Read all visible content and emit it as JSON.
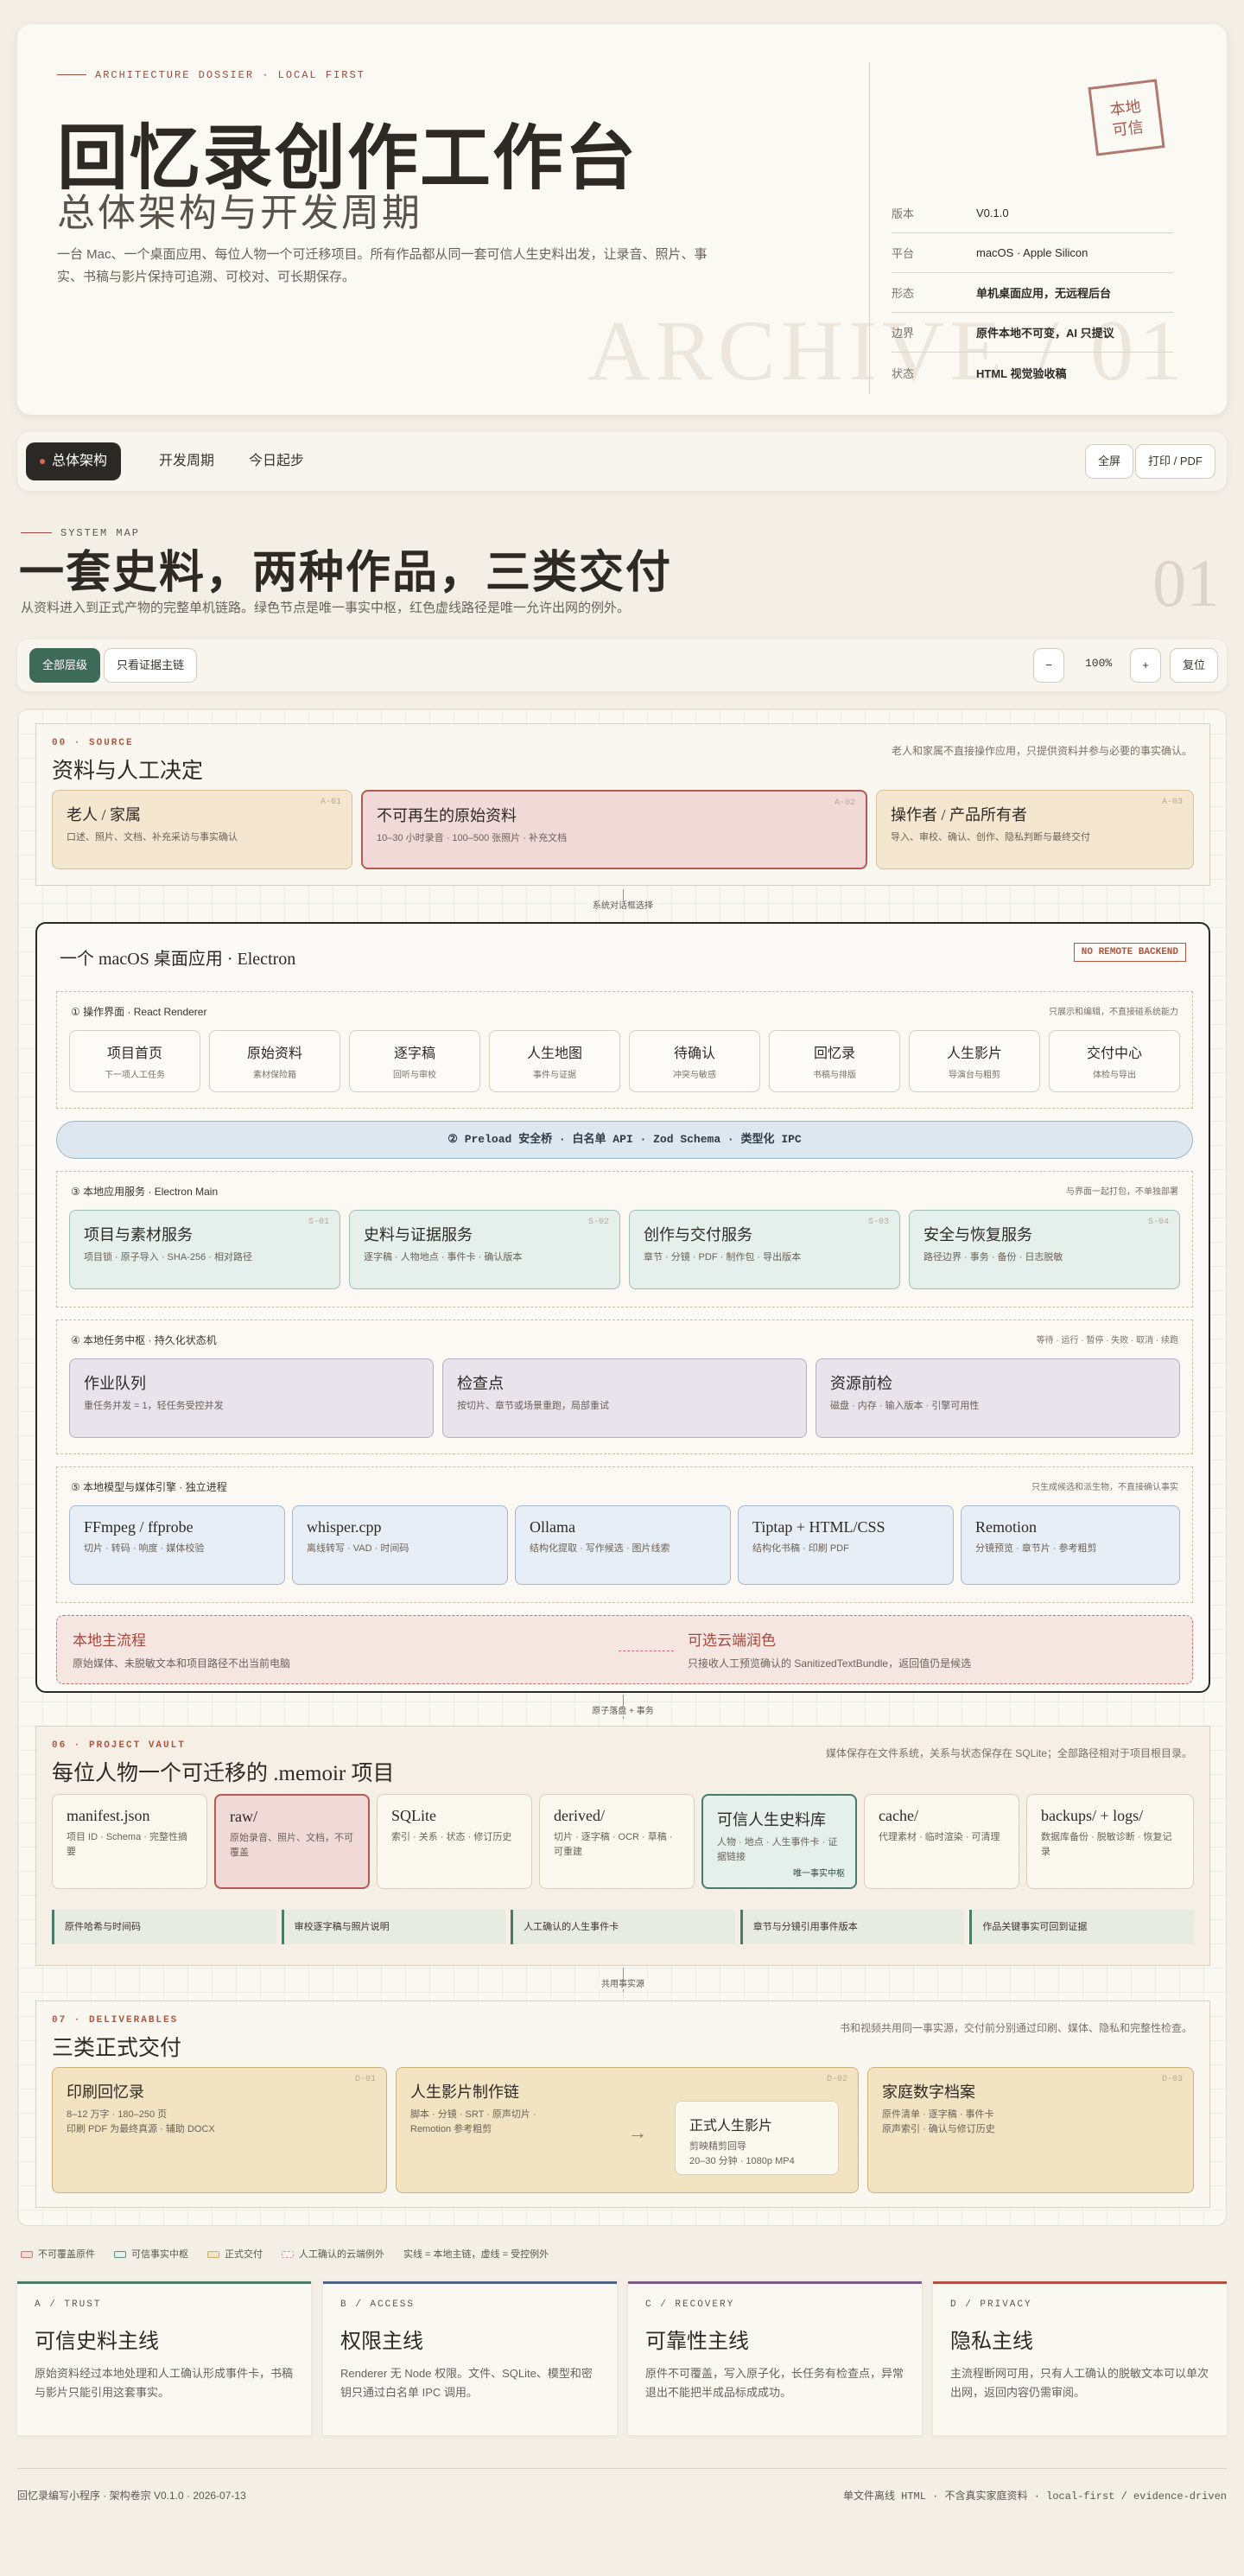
{
  "hero": {
    "kicker": "ARCHITECTURE DOSSIER · LOCAL FIRST",
    "title": "回忆录创作工作台",
    "subtitle": "总体架构与开发周期",
    "desc": "一台 Mac、一个桌面应用、每位人物一个可迁移项目。所有作品都从同一套可信人生史料出发，让录音、照片、事实、书稿与影片保持可追溯、可校对、可长期保存。",
    "watermark": "ARCHIVE / 01",
    "stamp": [
      "本地",
      "可信"
    ],
    "meta": [
      {
        "k": "版本",
        "v": "V0.1.0"
      },
      {
        "k": "平台",
        "v": "macOS · Apple Silicon"
      },
      {
        "k": "形态",
        "v": "单机桌面应用，无远程后台"
      },
      {
        "k": "边界",
        "v": "原件本地不可变，AI 只提议"
      },
      {
        "k": "状态",
        "v": "HTML 视觉验收稿"
      }
    ]
  },
  "tabs": [
    {
      "label": "总体架构"
    },
    {
      "label": "开发周期"
    },
    {
      "label": "今日起步"
    }
  ],
  "actions": {
    "fullscreen": "全屏",
    "print": "打印 / PDF"
  },
  "section": {
    "kicker": "SYSTEM MAP",
    "title": "一套史料，两种作品，三类交付",
    "desc": "从资料进入到正式产物的完整单机链路。绿色节点是唯一事实中枢，红色虚线路径是唯一允许出网的例外。",
    "num": "01"
  },
  "controls": {
    "all": "全部层级",
    "evidence": "只看证据主链",
    "minus": "−",
    "zoom": "100%",
    "plus": "+",
    "reset": "复位"
  },
  "source": {
    "kicker": "00 · SOURCE",
    "title": "资料与人工决定",
    "note": "老人和家属不直接操作应用，只提供资料并参与必要的事实确认。",
    "cards": [
      {
        "t": "老人 / 家属",
        "s": "口述、照片、文档、补充采访与事实确认",
        "id": "A-01"
      },
      {
        "t": "不可再生的原始资料",
        "s": "10–30 小时录音 · 100–500 张照片 · 补充文档",
        "id": "A-02"
      },
      {
        "t": "操作者 / 产品所有者",
        "s": "导入、审校、确认、创作、隐私判断与最终交付",
        "id": "A-03"
      }
    ]
  },
  "conn1": "系统对话框选择",
  "conn2": "原子落盘 + 事务",
  "conn3": "共用事实源",
  "app": {
    "title": "一个 macOS 桌面应用 · Electron",
    "badge": "NO REMOTE BACKEND",
    "ui": {
      "label": "① 操作界面 · React Renderer",
      "note": "只展示和编辑，不直接碰系统能力",
      "items": [
        {
          "t": "项目首页",
          "s": "下一项人工任务"
        },
        {
          "t": "原始资料",
          "s": "素材保险箱"
        },
        {
          "t": "逐字稿",
          "s": "回听与审校"
        },
        {
          "t": "人生地图",
          "s": "事件与证据"
        },
        {
          "t": "待确认",
          "s": "冲突与敏感"
        },
        {
          "t": "回忆录",
          "s": "书稿与排版"
        },
        {
          "t": "人生影片",
          "s": "导演台与粗剪"
        },
        {
          "t": "交付中心",
          "s": "体检与导出"
        }
      ]
    },
    "bridge": "② Preload 安全桥 · 白名单 API · Zod Schema · 类型化 IPC",
    "svc": {
      "label": "③ 本地应用服务 · Electron Main",
      "note": "与界面一起打包，不单独部署",
      "items": [
        {
          "t": "项目与素材服务",
          "s": "项目锁 · 原子导入 · SHA-256 · 相对路径",
          "id": "S-01"
        },
        {
          "t": "史料与证据服务",
          "s": "逐字稿 · 人物地点 · 事件卡 · 确认版本",
          "id": "S-02"
        },
        {
          "t": "创作与交付服务",
          "s": "章节 · 分镜 · PDF · 制作包 · 导出版本",
          "id": "S-03"
        },
        {
          "t": "安全与恢复服务",
          "s": "路径边界 · 事务 · 备份 · 日志脱敏",
          "id": "S-04"
        }
      ]
    },
    "task": {
      "label": "④ 本地任务中枢 · 持久化状态机",
      "note": "等待 · 运行 · 暂停 · 失败 · 取消 · 续跑",
      "items": [
        {
          "t": "作业队列",
          "s": "重任务并发 = 1，轻任务受控并发"
        },
        {
          "t": "检查点",
          "s": "按切片、章节或场景重跑，局部重试"
        },
        {
          "t": "资源前检",
          "s": "磁盘 · 内存 · 输入版本 · 引擎可用性"
        }
      ]
    },
    "eng": {
      "label": "⑤ 本地模型与媒体引擎 · 独立进程",
      "note": "只生成候选和派生物，不直接确认事实",
      "items": [
        {
          "t": "FFmpeg / ffprobe",
          "s": "切片 · 转码 · 响度 · 媒体校验"
        },
        {
          "t": "whisper.cpp",
          "s": "离线转写 · VAD · 时间码"
        },
        {
          "t": "Ollama",
          "s": "结构化提取 · 写作候选 · 图片线索"
        },
        {
          "t": "Tiptap + HTML/CSS",
          "s": "结构化书稿 · 印刷 PDF"
        },
        {
          "t": "Remotion",
          "s": "分镜预览 · 章节片 · 参考粗剪"
        }
      ]
    },
    "local": {
      "t": "本地主流程",
      "s": "原始媒体、未脱敏文本和项目路径不出当前电脑"
    },
    "cloud": {
      "t": "可选云端润色",
      "s": "只接收人工预览确认的 SanitizedTextBundle，返回值仍是候选"
    }
  },
  "vault": {
    "kicker": "06 · PROJECT VAULT",
    "title": "每位人物一个可迁移的 .memoir 项目",
    "note": "媒体保存在文件系统，关系与状态保存在 SQLite；全部路径相对于项目根目录。",
    "items": [
      {
        "t": "manifest.json",
        "s": "项目 ID · Schema · 完整性摘要"
      },
      {
        "t": "raw/",
        "s": "原始录音、照片、文档，不可覆盖"
      },
      {
        "t": "SQLite",
        "s": "索引 · 关系 · 状态 · 修订历史"
      },
      {
        "t": "derived/",
        "s": "切片 · 逐字稿 · OCR · 草稿 · 可重建"
      },
      {
        "t": "可信人生史料库",
        "s": "人物 · 地点 · 人生事件卡 · 证据链接",
        "tag": "唯一事实中枢"
      },
      {
        "t": "cache/",
        "s": "代理素材 · 临时渲染 · 可清理"
      },
      {
        "t": "backups/ + logs/",
        "s": "数据库备份 · 脱敏诊断 · 恢复记录"
      }
    ],
    "chain": [
      "原件哈希与时间码",
      "审校逐字稿与照片说明",
      "人工确认的人生事件卡",
      "章节与分镜引用事件版本",
      "作品关键事实可回到证据"
    ]
  },
  "deliv": {
    "kicker": "07 · DELIVERABLES",
    "title": "三类正式交付",
    "note": "书和视频共用同一事实源，交付前分别通过印刷、媒体、隐私和完整性检查。",
    "items": [
      {
        "t": "印刷回忆录",
        "s": "8–12 万字 · 180–250 页\n印刷 PDF 为最终真源 · 辅助 DOCX",
        "id": "D-01"
      },
      {
        "t": "人生影片制作链",
        "s": "脚本 · 分镜 · SRT · 原声切片 · Remotion 参考粗剪",
        "id": "D-02",
        "sub": {
          "t": "正式人生影片",
          "s": "剪映精剪回导\n20–30 分钟 · 1080p MP4"
        }
      },
      {
        "t": "家庭数字档案",
        "s": "原件清单 · 逐字稿 · 事件卡\n原声索引 · 确认与修订历史",
        "id": "D-03"
      }
    ]
  },
  "legend": [
    {
      "t": "不可覆盖原件",
      "c": "#c77a70"
    },
    {
      "t": "可信事实中枢",
      "c": "#5f8f7c"
    },
    {
      "t": "正式交付",
      "c": "#c9ad6f"
    },
    {
      "t": "人工确认的云端例外",
      "c": "#c9a0a0"
    }
  ],
  "legend_note": "实线 = 本地主链，虚线 = 受控例外",
  "principles": [
    {
      "k": "A / TRUST",
      "t": "可信史料主线",
      "d": "原始资料经过本地处理和人工确认形成事件卡，书稿与影片只能引用这套事实。",
      "c": "#4a7a68"
    },
    {
      "k": "B / ACCESS",
      "t": "权限主线",
      "d": "Renderer 无 Node 权限。文件、SQLite、模型和密钥只通过白名单 IPC 调用。",
      "c": "#4f6288"
    },
    {
      "k": "C / RECOVERY",
      "t": "可靠性主线",
      "d": "原件不可覆盖，写入原子化，长任务有检查点，异常退出不能把半成品标成成功。",
      "c": "#7a5d86"
    },
    {
      "k": "D / PRIVACY",
      "t": "隐私主线",
      "d": "主流程断网可用，只有人工确认的脱敏文本可以单次出网，返回内容仍需审阅。",
      "c": "#b05040"
    }
  ],
  "footer": {
    "left": "回忆录编写小程序 · 架构卷宗 V0.1.0 · 2026-07-13",
    "right": "单文件离线 HTML · 不含真实家庭资料 · local-first / evidence-driven"
  }
}
